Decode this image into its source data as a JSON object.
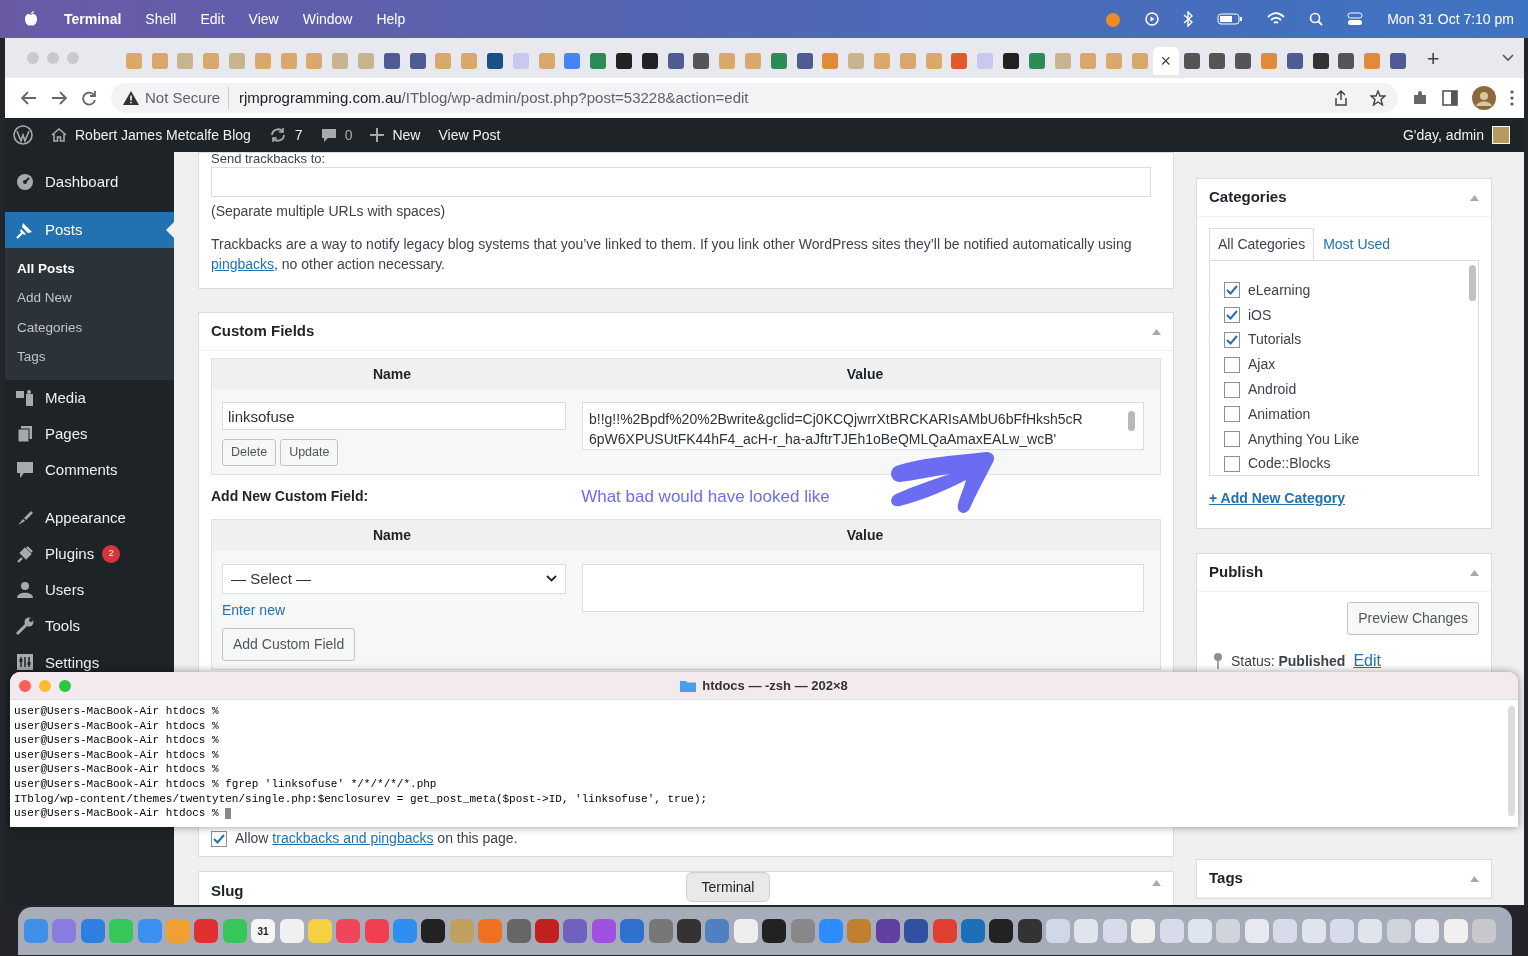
{
  "menu_bar": {
    "app": "Terminal",
    "menus": [
      "Shell",
      "Edit",
      "View",
      "Window",
      "Help"
    ],
    "clock": "Mon 31 Oct  7:10 pm"
  },
  "browser": {
    "tabs": [
      {
        "selected": false,
        "color": "#d9a86c"
      },
      {
        "selected": false,
        "color": "#d9a86c"
      },
      {
        "selected": false,
        "color": "#c8b48e"
      },
      {
        "selected": false,
        "color": "#d9a86c"
      },
      {
        "selected": false,
        "color": "#c8b48e"
      },
      {
        "selected": false,
        "color": "#d9a86c"
      },
      {
        "selected": false,
        "color": "#d9a86c"
      },
      {
        "selected": false,
        "color": "#d9a86c"
      },
      {
        "selected": false,
        "color": "#c8b48e"
      },
      {
        "selected": false,
        "color": "#c8b48e"
      },
      {
        "selected": false,
        "color": "#4f5b93"
      },
      {
        "selected": false,
        "color": "#4f5b93"
      },
      {
        "selected": false,
        "color": "#d9a86c"
      },
      {
        "selected": false,
        "color": "#d9a86c"
      },
      {
        "selected": false,
        "color": "#1a4f8a"
      },
      {
        "selected": false,
        "color": "#c9c9ef"
      },
      {
        "selected": false,
        "color": "#d9a86c"
      },
      {
        "selected": false,
        "color": "#4285f4"
      },
      {
        "selected": false,
        "color": "#2e8b57"
      },
      {
        "selected": false,
        "color": "#222222"
      },
      {
        "selected": false,
        "color": "#222222"
      },
      {
        "selected": false,
        "color": "#4f5b93"
      },
      {
        "selected": false,
        "color": "#555555"
      },
      {
        "selected": false,
        "color": "#d9a86c"
      },
      {
        "selected": false,
        "color": "#d9a86c"
      },
      {
        "selected": false,
        "color": "#2e8b57"
      },
      {
        "selected": false,
        "color": "#4f5b93"
      },
      {
        "selected": false,
        "color": "#e08a3c"
      },
      {
        "selected": false,
        "color": "#c8b48e"
      },
      {
        "selected": false,
        "color": "#d9a86c"
      },
      {
        "selected": false,
        "color": "#d9a86c"
      },
      {
        "selected": false,
        "color": "#d9a86c"
      },
      {
        "selected": false,
        "color": "#e05a2a"
      },
      {
        "selected": false,
        "color": "#c9c9ef"
      },
      {
        "selected": false,
        "color": "#222222"
      },
      {
        "selected": false,
        "color": "#2e8b57"
      },
      {
        "selected": false,
        "color": "#c8b48e"
      },
      {
        "selected": false,
        "color": "#d9a86c"
      },
      {
        "selected": false,
        "color": "#d9a86c"
      },
      {
        "selected": false,
        "color": "#d9a86c"
      },
      {
        "selected": true,
        "color": "#ffffff",
        "close": "×"
      },
      {
        "selected": false,
        "color": "#555555"
      },
      {
        "selected": false,
        "color": "#555555"
      },
      {
        "selected": false,
        "color": "#555555"
      },
      {
        "selected": false,
        "color": "#e08a3c"
      },
      {
        "selected": false,
        "color": "#4f5b93"
      },
      {
        "selected": false,
        "color": "#333333"
      },
      {
        "selected": false,
        "color": "#555555"
      },
      {
        "selected": false,
        "color": "#e08a3c"
      },
      {
        "selected": false,
        "color": "#4f5b93"
      }
    ],
    "new_tab": "+",
    "address": {
      "security": "Not Secure",
      "host": "rjmprogramming.com.au",
      "path": "/ITblog/wp-admin/post.php?post=53228&action=edit"
    }
  },
  "admin_bar": {
    "site": "Robert James Metcalfe Blog",
    "updates": "7",
    "comments": "0",
    "new": "New",
    "view": "View Post",
    "greeting": "G'day, admin"
  },
  "sidebar": {
    "groups": [
      {
        "items": [
          {
            "kind": "dashboard",
            "label": "Dashboard",
            "selected": false
          }
        ]
      },
      {
        "items": [
          {
            "kind": "posts",
            "label": "Posts",
            "selected": true,
            "submenu": [
              {
                "label": "All Posts",
                "selected": true
              },
              {
                "label": "Add New",
                "selected": false
              },
              {
                "label": "Categories",
                "selected": false
              },
              {
                "label": "Tags",
                "selected": false
              }
            ]
          },
          {
            "kind": "media",
            "label": "Media",
            "selected": false
          },
          {
            "kind": "pages",
            "label": "Pages",
            "selected": false
          },
          {
            "kind": "comments",
            "label": "Comments",
            "selected": false
          }
        ]
      },
      {
        "items": [
          {
            "kind": "appearance",
            "label": "Appearance",
            "selected": false
          },
          {
            "kind": "plugins",
            "label": "Plugins",
            "selected": false,
            "badge": "2"
          },
          {
            "kind": "users",
            "label": "Users",
            "selected": false
          },
          {
            "kind": "tools",
            "label": "Tools",
            "selected": false
          },
          {
            "kind": "settings",
            "label": "Settings",
            "selected": false
          }
        ]
      }
    ]
  },
  "trackbacks": {
    "label": "Send trackbacks to:",
    "hint": "(Separate multiple URLs with spaces)",
    "text_before": "Trackbacks are a way to notify legacy blog systems that you’ve linked to them. If you link other WordPress sites they’ll be notified automatically using",
    "link": "pingbacks",
    "text_after": ", no other action necessary."
  },
  "custom_fields": {
    "title": "Custom Fields",
    "columns": [
      "Name",
      "Value"
    ],
    "rows": [
      {
        "name": "linksofuse",
        "value_lines": [
          "b!!g!!%2Bpdf%20%2Bwrite&gclid=Cj0KCQjwrrXtBRCKARIsAMbU6bFfHksh5cR",
          "6pW6XPUSUtFK44hF4_acH-r_ha-aJftrTJEh1oBeQMLQaAmaxEALw_wcB'"
        ],
        "buttons": [
          "Delete",
          "Update"
        ]
      }
    ],
    "add_new": {
      "heading": "Add New Custom Field:",
      "columns": [
        "Name",
        "Value"
      ],
      "select": "— Select —",
      "enter_new": "Enter new",
      "button": "Add Custom Field"
    }
  },
  "annotation": {
    "text": "What bad would have looked like"
  },
  "categories": {
    "title": "Categories",
    "tabs": [
      {
        "label": "All Categories",
        "selected": true
      },
      {
        "label": "Most Used",
        "selected": false
      }
    ],
    "items": [
      {
        "label": "eLearning",
        "checked": true
      },
      {
        "label": "iOS",
        "checked": true
      },
      {
        "label": "Tutorials",
        "checked": true
      },
      {
        "label": "Ajax",
        "checked": false
      },
      {
        "label": "Android",
        "checked": false
      },
      {
        "label": "Animation",
        "checked": false
      },
      {
        "label": "Anything You Like",
        "checked": false
      },
      {
        "label": "Code::Blocks",
        "checked": false
      }
    ],
    "add_link": "+ Add New Category"
  },
  "publish": {
    "title": "Publish",
    "preview": "Preview Changes",
    "status_label": "Status:",
    "status": "Published",
    "edit": "Edit"
  },
  "discussion": {
    "checked": true,
    "before": "Allow",
    "link": "trackbacks and pingbacks",
    "after": "on this page."
  },
  "slug": {
    "title": "Slug"
  },
  "tags": {
    "title": "Tags"
  },
  "terminal": {
    "title": "htdocs — -zsh — 202×8",
    "lines": [
      "user@Users-MacBook-Air htdocs %",
      "user@Users-MacBook-Air htdocs %",
      "user@Users-MacBook-Air htdocs %",
      "user@Users-MacBook-Air htdocs %",
      "user@Users-MacBook-Air htdocs %",
      "user@Users-MacBook-Air htdocs % fgrep 'linksofuse' */*/*/*/*.php",
      "ITblog/wp-content/themes/twentyten/single.php:$enclosurev = get_post_meta($post->ID, 'linksofuse', true);",
      "user@Users-MacBook-Air htdocs %"
    ]
  },
  "tooltip": "Terminal",
  "dock": {
    "items": [
      {
        "color": "#3d8fe8"
      },
      {
        "color": "#8a7be0"
      },
      {
        "color": "#2f7fe0"
      },
      {
        "color": "#35c759"
      },
      {
        "color": "#3b8ff0"
      },
      {
        "color": "#f0a030"
      },
      {
        "color": "#e03030"
      },
      {
        "color": "#35c759"
      },
      {
        "color": "#f5f5f5",
        "label": "31"
      },
      {
        "color": "#f0f0f0"
      },
      {
        "color": "#f5d040"
      },
      {
        "color": "#f0455a"
      },
      {
        "color": "#f04050"
      },
      {
        "color": "#2f8ff0"
      },
      {
        "color": "#222222"
      },
      {
        "color": "#c0a060"
      },
      {
        "color": "#f07020"
      },
      {
        "color": "#666666"
      },
      {
        "color": "#c02020"
      },
      {
        "color": "#7060c0"
      },
      {
        "color": "#a050e0"
      },
      {
        "color": "#3070d0"
      },
      {
        "color": "#777777"
      },
      {
        "color": "#333333"
      },
      {
        "color": "#5080c0"
      },
      {
        "color": "#eeeeee"
      },
      {
        "color": "#222222"
      },
      {
        "color": "#888888"
      },
      {
        "color": "#2d8cff"
      },
      {
        "color": "#c08030"
      },
      {
        "color": "#6040a0"
      },
      {
        "color": "#3050a0"
      },
      {
        "color": "#e04030"
      },
      {
        "color": "#1d6fb8"
      },
      {
        "color": "#222222"
      },
      {
        "color": "#333333"
      },
      {
        "color": "#d0d8e8"
      },
      {
        "color": "#e0e4ec"
      },
      {
        "color": "#d8dce8"
      },
      {
        "color": "#eeeeee"
      },
      {
        "color": "#d8dce8"
      },
      {
        "color": "#e0e4ec"
      },
      {
        "color": "#d0d4dc"
      },
      {
        "color": "#e8e8f0"
      },
      {
        "color": "#d8dce8"
      },
      {
        "color": "#e0e4ec"
      },
      {
        "color": "#d8dce8"
      },
      {
        "color": "#e0e4ec"
      },
      {
        "color": "#d0d4dc"
      },
      {
        "color": "#e8e8f0"
      },
      {
        "color": "#f0f0f0"
      },
      {
        "color": "#c8c8cc"
      }
    ]
  }
}
